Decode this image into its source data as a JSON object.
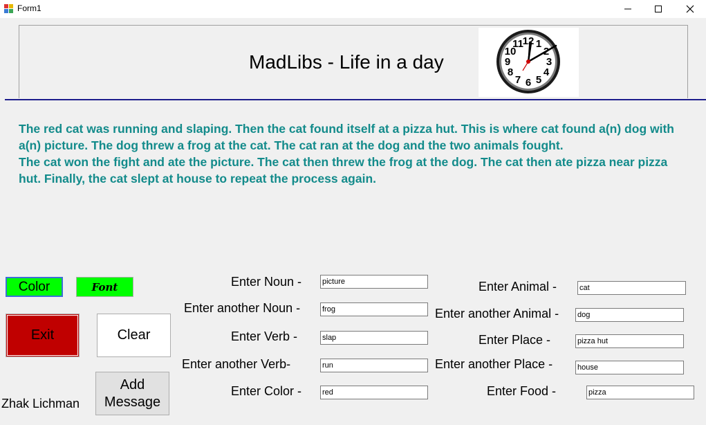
{
  "window": {
    "title": "Form1"
  },
  "header": {
    "title": "MadLibs - Life in a day"
  },
  "story": {
    "line1": "The red cat was running and slaping. Then the cat found itself at a pizza hut. This is where cat found a(n) dog with a(n) picture. The dog threw a frog at the cat. The cat ran at the dog and the two animals fought.",
    "line2": "The cat won the fight and ate the picture. The cat then threw the frog at the dog. The cat then ate pizza near pizza hut. Finally, the cat slept at house to repeat the process again."
  },
  "buttons": {
    "color": "Color",
    "font": "Font",
    "exit": "Exit",
    "clear": "Clear",
    "add_message_line1": "Add",
    "add_message_line2": "Message"
  },
  "author": "Zhak Lichman",
  "fields": {
    "noun": {
      "label": "Enter Noun -",
      "value": "picture"
    },
    "noun2": {
      "label": "Enter another Noun -",
      "value": "frog"
    },
    "verb": {
      "label": "Enter Verb -",
      "value": "slap"
    },
    "verb2": {
      "label": "Enter another Verb-",
      "value": "run"
    },
    "color": {
      "label": "Enter Color -",
      "value": "red"
    },
    "animal": {
      "label": "Enter Animal -",
      "value": "cat"
    },
    "animal2": {
      "label": "Enter another Animal -",
      "value": "dog"
    },
    "place": {
      "label": "Enter Place  -",
      "value": "pizza hut"
    },
    "place2": {
      "label": "Enter another Place -",
      "value": "house"
    },
    "food": {
      "label": "Enter  Food -",
      "value": "pizza"
    }
  },
  "colors": {
    "story_text": "#138b8b",
    "exit_bg": "#c00000",
    "toggle_bg": "#00ff00",
    "rule": "#1c1c8c"
  },
  "clock": {
    "numerals": [
      "12",
      "1",
      "2",
      "3",
      "4",
      "5",
      "6",
      "7",
      "8",
      "9",
      "10",
      "11"
    ]
  }
}
